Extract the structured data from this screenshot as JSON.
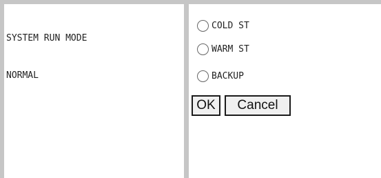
{
  "status": {
    "label": "SYSTEM RUN MODE",
    "value": "NORMAL"
  },
  "mode_options": [
    {
      "label": "COLD ST",
      "selected": false
    },
    {
      "label": "WARM ST",
      "selected": false
    },
    {
      "label": "BACKUP",
      "selected": false
    }
  ],
  "buttons": {
    "ok": "OK",
    "cancel": "Cancel"
  },
  "colors": {
    "frame": "#c6c6c6",
    "background": "#ffffff"
  }
}
